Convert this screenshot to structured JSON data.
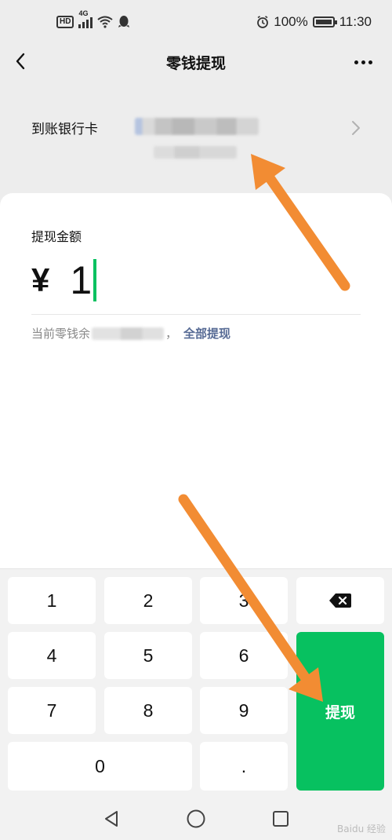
{
  "status_bar": {
    "hd": "HD",
    "network": "4G",
    "battery": "100%",
    "time": "11:30"
  },
  "nav": {
    "title": "零钱提现",
    "back_icon": "chevron-left-icon",
    "more_icon": "more-dots-icon"
  },
  "bank": {
    "label": "到账银行卡"
  },
  "amount": {
    "label": "提现金额",
    "currency": "¥",
    "value": "1"
  },
  "balance": {
    "prefix": "当前零钱余",
    "comma": "，",
    "withdraw_all": "全部提现"
  },
  "keypad": {
    "keys": [
      "1",
      "2",
      "3",
      "4",
      "5",
      "6",
      "7",
      "8",
      "9",
      "0",
      "."
    ],
    "backspace_icon": "backspace-icon",
    "submit": "提现"
  },
  "colors": {
    "accent": "#07c160",
    "link": "#576b95",
    "annotation": "#f28c33"
  },
  "watermark": "Baidu 经验"
}
